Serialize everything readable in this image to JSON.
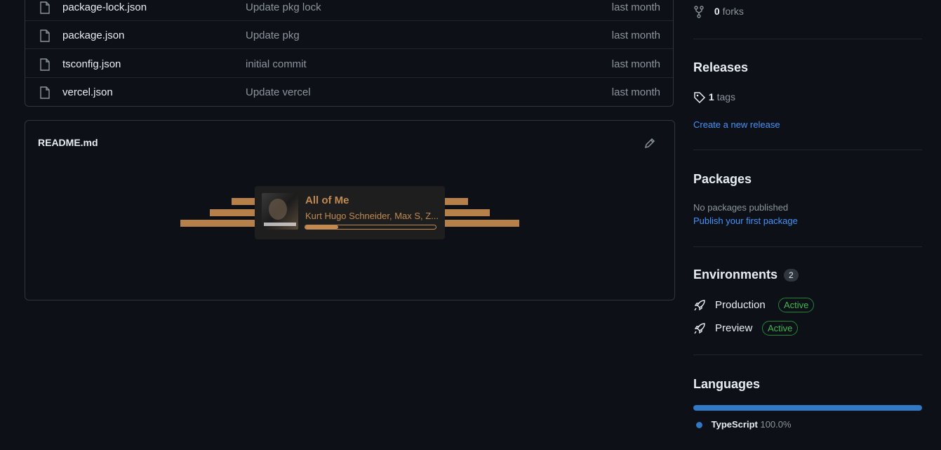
{
  "files": [
    {
      "name": "package-lock.json",
      "message": "Update pkg lock",
      "date": "last month"
    },
    {
      "name": "package.json",
      "message": "Update pkg",
      "date": "last month"
    },
    {
      "name": "tsconfig.json",
      "message": "initial commit",
      "date": "last month"
    },
    {
      "name": "vercel.json",
      "message": "Update vercel",
      "date": "last month"
    }
  ],
  "readme": {
    "title": "README.md",
    "player": {
      "song": "All of Me",
      "artist": "Kurt Hugo Schneider, Max S, Z...",
      "progress": 0.25
    }
  },
  "sidebar": {
    "forks_count": "0",
    "forks_label": "forks",
    "releases_title": "Releases",
    "tags_count": "1",
    "tags_label": "tags",
    "create_release": "Create a new release",
    "packages_title": "Packages",
    "no_packages": "No packages published",
    "publish_package": "Publish your first package",
    "environments_title": "Environments",
    "environments_count": "2",
    "environments": [
      {
        "name": "Production",
        "status": "Active"
      },
      {
        "name": "Preview",
        "status": "Active"
      }
    ],
    "languages_title": "Languages",
    "language_name": "TypeScript",
    "language_percent": "100.0%"
  },
  "colors": {
    "accent_link": "#4493f8",
    "active_green": "#3fb950",
    "typescript": "#3178c6",
    "player_accent": "#c08a52"
  }
}
